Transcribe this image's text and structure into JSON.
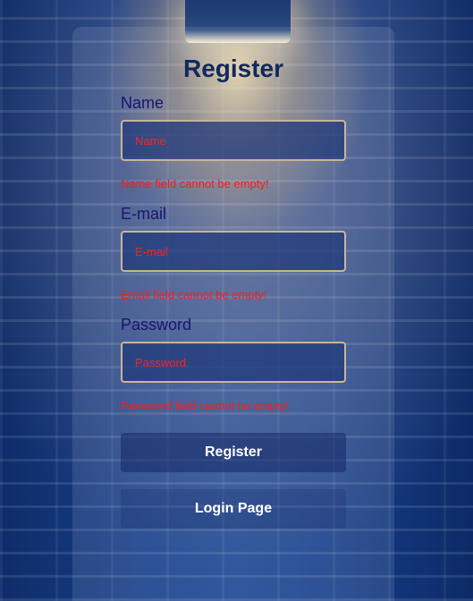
{
  "form": {
    "title": "Register",
    "fields": [
      {
        "label": "Name",
        "placeholder": "Name",
        "value": "",
        "error": "Name field cannot be empty!"
      },
      {
        "label": "E-mail",
        "placeholder": "E-mail",
        "value": "",
        "error": "Email field cannot be empty!"
      },
      {
        "label": "Password",
        "placeholder": "Password",
        "value": "",
        "error": "Password field cannot be empty!"
      }
    ],
    "register_label": "Register",
    "login_label": "Login Page"
  },
  "colors": {
    "title": "#12285e",
    "label": "#1c1470",
    "error": "#ff1a1a",
    "button_text": "#ffffff",
    "input_border": "#c9b49a"
  }
}
